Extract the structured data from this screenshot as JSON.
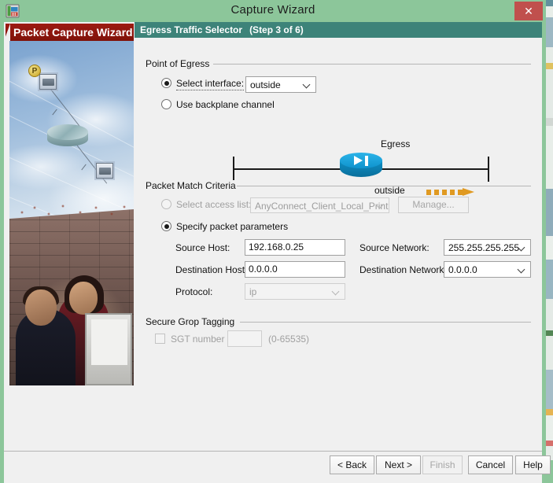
{
  "window": {
    "title": "Capture Wizard",
    "icon": "capture-wizard-icon",
    "close_label": "✕"
  },
  "sidebar": {
    "banner": "Packet Capture Wizard",
    "artwork_alt": "network-topology-over-sky-and-people-at-computer"
  },
  "step_header": {
    "title": "Egress Traffic Selector",
    "step": "(Step 3 of 6)"
  },
  "point_of_egress": {
    "group_title": "Point of Egress",
    "select_interface": {
      "label": "Select interface:",
      "checked": true,
      "focused": true,
      "value": "outside"
    },
    "use_backplane": {
      "label": "Use backplane channel",
      "checked": false
    }
  },
  "diagram": {
    "egress_label": "Egress",
    "interface_label": "outside",
    "device_icon": "firewall-cylinder-icon",
    "arrow_icon": "dashed-arrow-right-icon",
    "arrow_color": "#e09a22",
    "device_color": "#0f93cd"
  },
  "packet_match_criteria": {
    "group_title": "Packet Match Criteria",
    "select_access_list": {
      "label": "Select access list:",
      "checked": false,
      "disabled": true,
      "value": "AnyConnect_Client_Local_Print"
    },
    "manage_button": {
      "label": "Manage...",
      "disabled": true
    },
    "specify_packet_parameters": {
      "label": "Specify packet parameters",
      "checked": true
    },
    "fields": [
      {
        "label": "Source Host:",
        "value": "192.168.0.25",
        "type": "text",
        "disabled": false
      },
      {
        "label": "Destination Host:",
        "value": "0.0.0.0",
        "type": "text",
        "disabled": false
      },
      {
        "label": "Protocol:",
        "value": "ip",
        "type": "combo",
        "disabled": true
      },
      {
        "label": "Source Network:",
        "value": "255.255.255.255",
        "type": "combo",
        "disabled": false
      },
      {
        "label": "Destination Network:",
        "value": "0.0.0.0",
        "type": "combo",
        "disabled": false
      }
    ]
  },
  "secure_group_tagging": {
    "group_title": "Secure Grop Tagging",
    "sgt_checkbox_label": "SGT number",
    "sgt_value": "",
    "sgt_range_hint": "(0-65535)",
    "disabled": true
  },
  "footer": {
    "buttons": [
      {
        "label": "< Back",
        "disabled": false
      },
      {
        "label": "Next >",
        "disabled": false
      },
      {
        "label": "Finish",
        "disabled": true
      },
      {
        "label": "Cancel",
        "disabled": false
      },
      {
        "label": "Help",
        "disabled": false
      }
    ]
  },
  "colors": {
    "window_chrome": "#8cc69a",
    "step_header": "#3d8379",
    "banner_red": "#8f150c",
    "close_red": "#c0504d"
  }
}
